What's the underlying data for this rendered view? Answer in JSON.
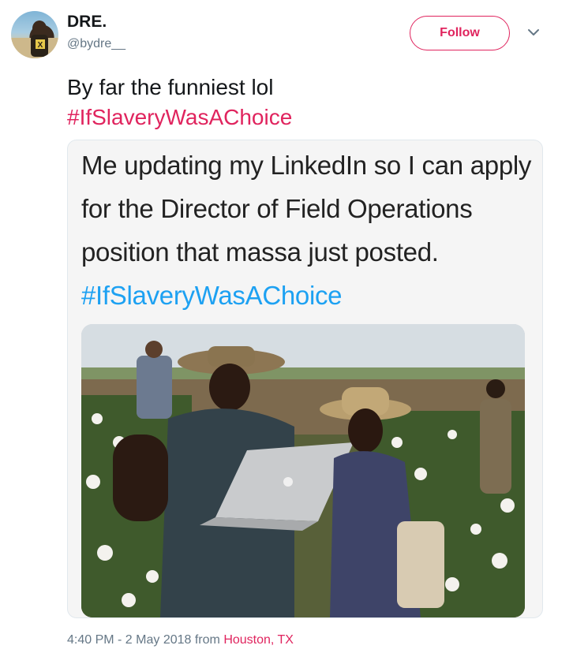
{
  "user": {
    "name": "DRE.",
    "handle": "@bydre__"
  },
  "follow_button": {
    "label": "Follow"
  },
  "tweet": {
    "text": "By far the funniest lol",
    "hashtag": "#IfSlaveryWasAChoice"
  },
  "media": {
    "meme_text": "Me updating my LinkedIn so I can apply for the Director of Field Operations position that massa just posted.",
    "meme_hashtag": "#IfSlaveryWasAChoice"
  },
  "footer": {
    "timestamp": "4:40 PM - 2 May 2018 from ",
    "location": "Houston, TX"
  },
  "colors": {
    "accent": "#e0245e",
    "link_blue": "#1da1f2",
    "muted": "#657786"
  },
  "icons": {
    "caret": "chevron-down-icon"
  }
}
